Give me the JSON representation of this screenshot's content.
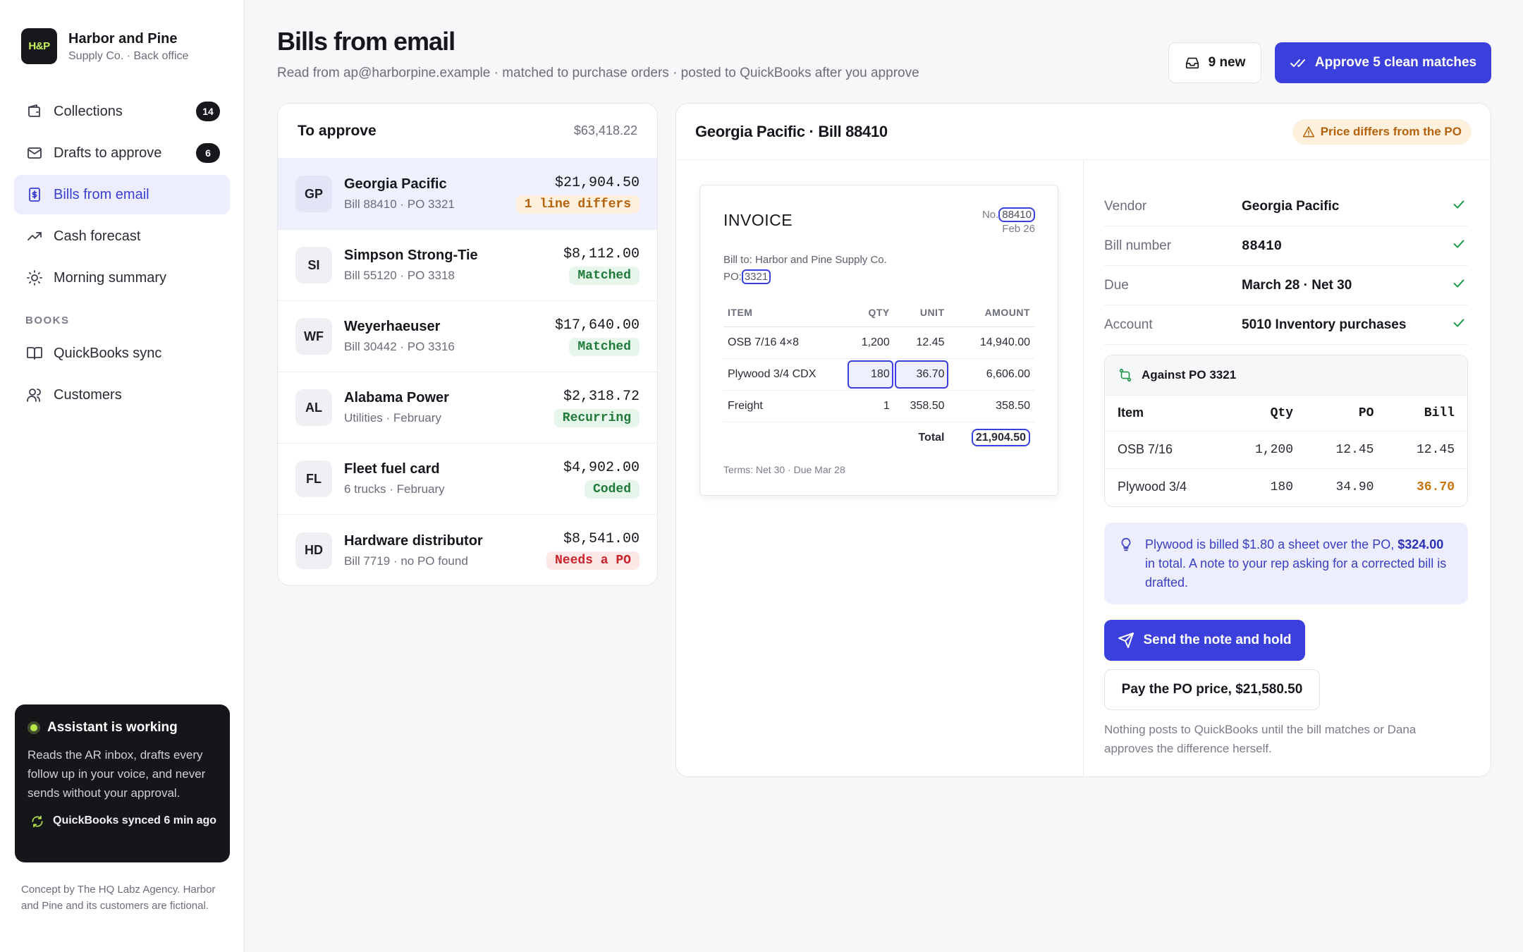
{
  "brand": {
    "logo": "H&P",
    "name": "Harbor and Pine",
    "sub": "Supply Co. · Back office"
  },
  "nav": {
    "items": [
      {
        "label": "Collections",
        "icon": "wallet-icon",
        "badge": "14"
      },
      {
        "label": "Drafts to approve",
        "icon": "mail-icon",
        "badge": "6"
      },
      {
        "label": "Bills from email",
        "icon": "receipt-icon",
        "active": true
      },
      {
        "label": "Cash forecast",
        "icon": "trend-up-icon"
      },
      {
        "label": "Morning summary",
        "icon": "sun-icon"
      }
    ],
    "section": "BOOKS",
    "books": [
      {
        "label": "QuickBooks sync",
        "icon": "book-icon"
      },
      {
        "label": "Customers",
        "icon": "users-icon"
      }
    ]
  },
  "assistant": {
    "title": "Assistant is working",
    "body": "Reads the AR inbox, drafts every follow up in your voice, and never sends without your approval.",
    "sync": "QuickBooks synced 6 min ago"
  },
  "footer": "Concept by The HQ Labz Agency. Harbor and Pine and its customers are fictional.",
  "header": {
    "title": "Bills from email",
    "subtitle": "Read from ap@harborpine.example · matched to purchase orders · posted to QuickBooks after you approve",
    "new_label": "9 new",
    "approve_label": "Approve 5 clean matches"
  },
  "list": {
    "title": "To approve",
    "total": "$63,418.22",
    "rows": [
      {
        "initials": "GP",
        "name": "Georgia Pacific",
        "sub": "Bill 88410 · PO 3321",
        "amount": "$21,904.50",
        "status": "1 line differs",
        "tone": "warn"
      },
      {
        "initials": "SI",
        "name": "Simpson Strong-Tie",
        "sub": "Bill 55120 · PO 3318",
        "amount": "$8,112.00",
        "status": "Matched",
        "tone": "ok"
      },
      {
        "initials": "WF",
        "name": "Weyerhaeuser",
        "sub": "Bill 30442 · PO 3316",
        "amount": "$17,640.00",
        "status": "Matched",
        "tone": "ok"
      },
      {
        "initials": "AL",
        "name": "Alabama Power",
        "sub": "Utilities · February",
        "amount": "$2,318.72",
        "status": "Recurring",
        "tone": "ok"
      },
      {
        "initials": "FL",
        "name": "Fleet fuel card",
        "sub": "6 trucks · February",
        "amount": "$4,902.00",
        "status": "Coded",
        "tone": "ok"
      },
      {
        "initials": "HD",
        "name": "Hardware distributor",
        "sub": "Bill 7719 · no PO found",
        "amount": "$8,541.00",
        "status": "Needs a PO",
        "tone": "bad"
      }
    ]
  },
  "detail": {
    "title": "Georgia Pacific · Bill 88410",
    "badge": "Price differs from the PO",
    "invoice": {
      "title": "INVOICE",
      "no_label": "No.",
      "no": "88410",
      "date": "Feb 26",
      "bill_to": "Bill to: Harbor and Pine Supply Co.",
      "po_label": "PO:",
      "po": "3321",
      "headers": [
        "ITEM",
        "QTY",
        "UNIT",
        "AMOUNT"
      ],
      "lines": [
        {
          "item": "OSB 7/16 4×8",
          "qty": "1,200",
          "unit": "12.45",
          "amount": "14,940.00"
        },
        {
          "item": "Plywood 3/4 CDX",
          "qty": "180",
          "unit": "36.70",
          "amount": "6,606.00"
        },
        {
          "item": "Freight",
          "qty": "1",
          "unit": "358.50",
          "amount": "358.50"
        }
      ],
      "total_label": "Total",
      "total": "21,904.50",
      "terms": "Terms: Net 30 · Due Mar 28"
    },
    "fields": [
      {
        "key": "Vendor",
        "value": "Georgia Pacific"
      },
      {
        "key": "Bill number",
        "value": "88410"
      },
      {
        "key": "Due",
        "value": "March 28 · Net 30"
      },
      {
        "key": "Account",
        "value": "5010 Inventory purchases"
      }
    ],
    "po": {
      "title": "Against PO 3321",
      "headers": [
        "Item",
        "Qty",
        "PO",
        "Bill"
      ],
      "rows": [
        {
          "item": "OSB 7/16",
          "qty": "1,200",
          "po": "12.45",
          "bill": "12.45"
        },
        {
          "item": "Plywood 3/4",
          "qty": "180",
          "po": "34.90",
          "bill": "36.70"
        }
      ]
    },
    "note": {
      "text": "Plywood is billed $1.80 a sheet over the PO,",
      "amount": "$324.00",
      "tail": "in total. A note to your rep asking for a corrected bill is drafted."
    },
    "send_label": "Send the note and hold",
    "pay_label": "Pay the PO price, $21,580.50",
    "hold_note": "Nothing posts to QuickBooks until the bill matches or Dana approves the difference herself."
  }
}
